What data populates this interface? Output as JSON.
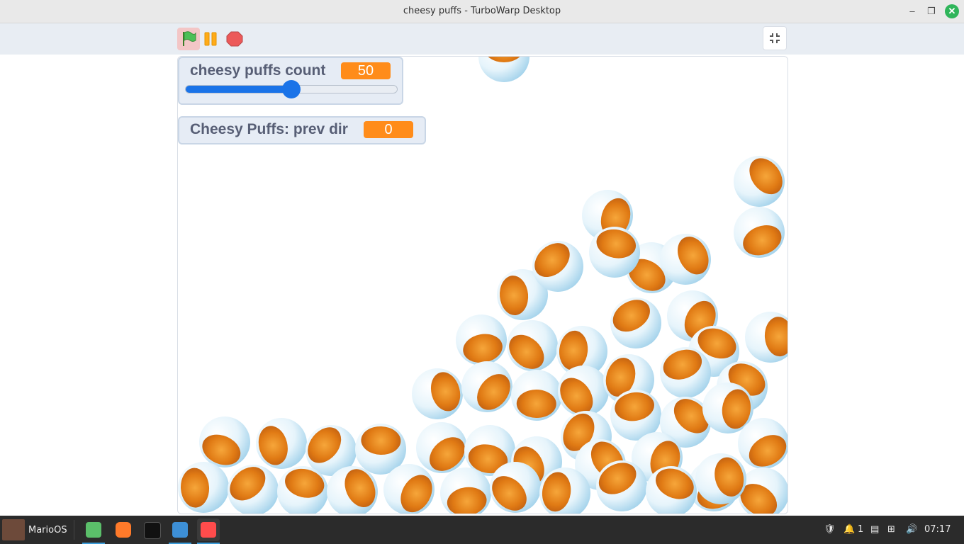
{
  "window": {
    "title": "cheesy puffs - TurboWarp Desktop",
    "min_glyph": "–",
    "max_glyph": "❐",
    "close_glyph": "✕"
  },
  "toolbar": {
    "green_flag_icon": "green-flag-icon",
    "pause_icon": "pause-icon",
    "stop_icon": "stop-icon",
    "fullscreen_icon": "exit-fullscreen-icon"
  },
  "monitors": {
    "count": {
      "label": "cheesy puffs count",
      "value": "50",
      "slider_fraction": 0.5
    },
    "prev_dir": {
      "label": "Cheesy Puffs: prev dir",
      "value": "0"
    }
  },
  "taskbar": {
    "start_label": "MarioOS",
    "apps": [
      "files-icon",
      "firefox-icon",
      "terminal-icon",
      "text-editor-icon",
      "turbowarp-icon"
    ],
    "tray": {
      "notifications": "1",
      "clock": "07:17"
    }
  },
  "colors": {
    "accent": "#ff8c1a",
    "slider": "#1a73e8",
    "monitor_text": "#575e75"
  }
}
